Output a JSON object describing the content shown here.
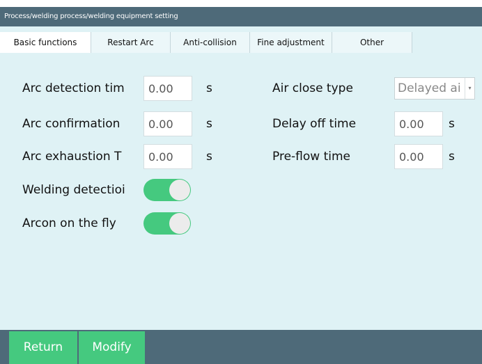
{
  "window": {
    "title": "Process/welding process/welding equipment setting"
  },
  "tabs": [
    {
      "label": "Basic functions"
    },
    {
      "label": "Restart Arc"
    },
    {
      "label": "Anti-collision"
    },
    {
      "label": "Fine adjustment"
    },
    {
      "label": "Other"
    }
  ],
  "left_fields": [
    {
      "label": "Arc detection tim",
      "value": "0.00",
      "unit": "s"
    },
    {
      "label": "Arc confirmation ",
      "value": "0.00",
      "unit": "s"
    },
    {
      "label": "Arc exhaustion T",
      "value": "0.00",
      "unit": "s"
    }
  ],
  "toggles": [
    {
      "label": "Welding detectioi",
      "on": true
    },
    {
      "label": "Arcon on the fly",
      "on": true
    }
  ],
  "right_fields": {
    "air_close_type": {
      "label": "Air close type",
      "value": "Delayed ai"
    },
    "delay_off_time": {
      "label": "Delay off time",
      "value": "0.00",
      "unit": "s"
    },
    "pre_flow_time": {
      "label": "Pre-flow time",
      "value": "0.00",
      "unit": "s"
    }
  },
  "buttons": {
    "return": "Return",
    "modify": "Modify"
  },
  "colors": {
    "header": "#4e6a79",
    "panel": "#dff2f5",
    "accent": "#45c97f"
  }
}
